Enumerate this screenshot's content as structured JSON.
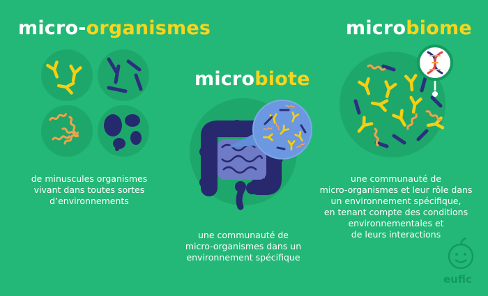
{
  "columns": [
    {
      "id": "micro-organismes",
      "title_part1": "micro-",
      "title_part2": "organismes",
      "description_lines": [
        "de minuscules organismes",
        "vivant dans toutes sortes",
        "d’environnements"
      ]
    },
    {
      "id": "microbiote",
      "title_part1": "micro",
      "title_part2": "biote",
      "description_lines": [
        "une communauté de",
        "micro-organismes dans un",
        "environnement spécifique"
      ]
    },
    {
      "id": "microbiome",
      "title_part1": "micro",
      "title_part2": "biome",
      "description_lines": [
        "une communauté de",
        "micro-organismes et leur rôle dans",
        "un environnement spécifique,",
        "en tenant compte des conditions",
        "environnementales et",
        "de leurs interactions"
      ]
    }
  ],
  "brand": {
    "name": "eufic",
    "logo_icon": "apple-face-icon"
  },
  "colors": {
    "background": "#23b877",
    "circle": "#1ea76a",
    "title_accent": "#f7d51d",
    "text": "#ffffff",
    "bacteria_yellow": "#f5cf12",
    "bacteria_navy": "#2b2f7e",
    "bacteria_orange": "#f2a24a",
    "gut_navy": "#27286d",
    "zoom_blue": "#6b98e0"
  }
}
